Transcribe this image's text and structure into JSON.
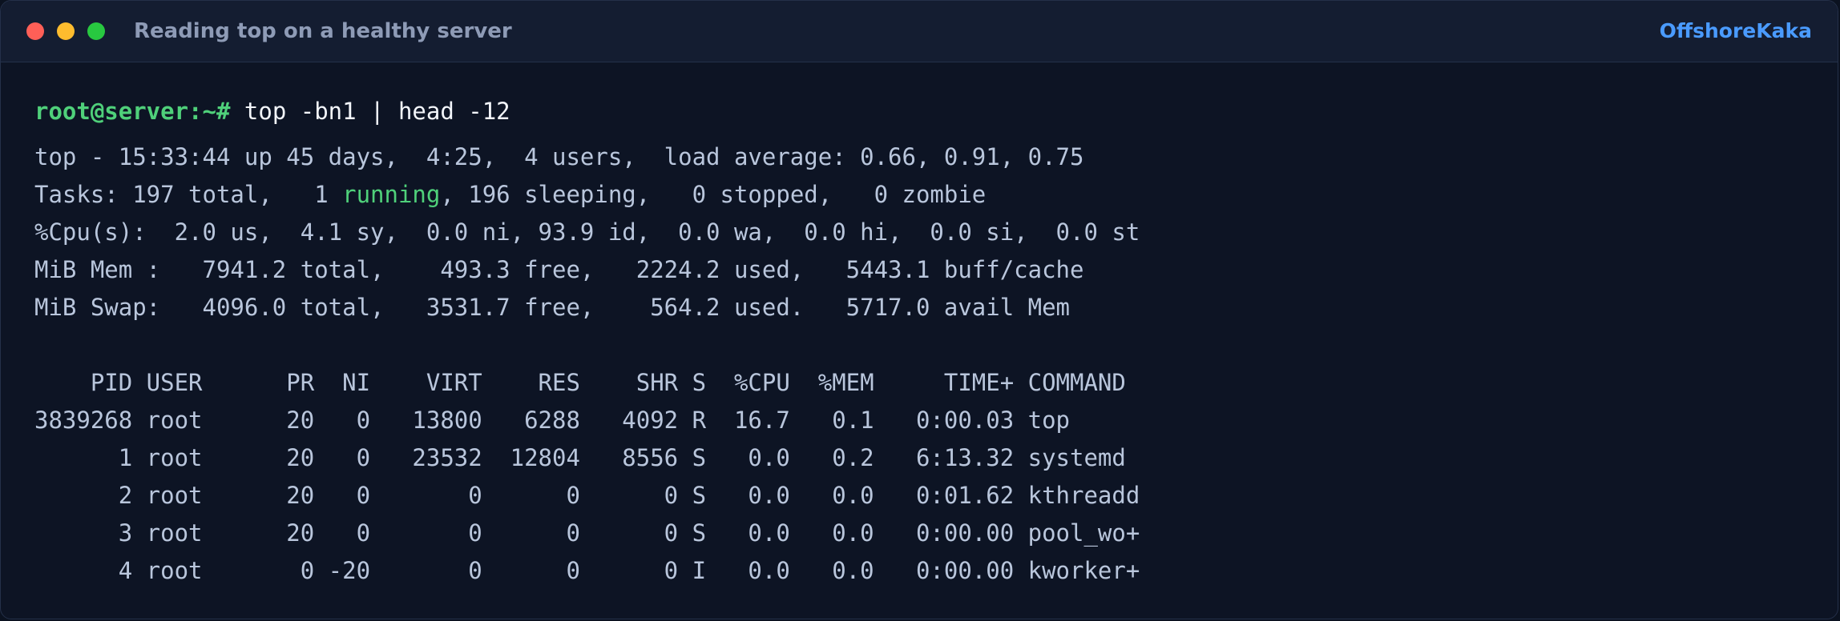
{
  "window": {
    "title": "Reading top on a healthy server",
    "brand": "OffshoreKaka",
    "controls": [
      "close",
      "minimize",
      "maximize"
    ]
  },
  "terminal": {
    "prompt": "root@server:~#",
    "command": " top -bn1 | head -12",
    "summary": {
      "uptime_line": "top - 15:33:44 up 45 days,  4:25,  4 users,  load average: 0.66, 0.91, 0.75",
      "tasks_prefix": "Tasks: 197 total,   1 ",
      "tasks_running": "running",
      "tasks_suffix": ", 196 sleeping,   0 stopped,   0 zombie",
      "cpu_line": "%Cpu(s):  2.0 us,  4.1 sy,  0.0 ni, 93.9 id,  0.0 wa,  0.0 hi,  0.0 si,  0.0 st",
      "mem_line": "MiB Mem :   7941.2 total,    493.3 free,   2224.2 used,   5443.1 buff/cache",
      "swap_line": "MiB Swap:   4096.0 total,   3531.7 free,    564.2 used.   5717.0 avail Mem"
    },
    "process_header": "    PID USER      PR  NI    VIRT    RES    SHR S  %CPU  %MEM     TIME+ COMMAND",
    "processes": [
      "3839268 root      20   0   13800   6288   4092 R  16.7   0.1   0:00.03 top",
      "      1 root      20   0   23532  12804   8556 S   0.0   0.2   6:13.32 systemd",
      "      2 root      20   0       0      0      0 S   0.0   0.0   0:01.62 kthreadd",
      "      3 root      20   0       0      0      0 S   0.0   0.0   0:00.00 pool_wo+",
      "      4 root       0 -20       0      0      0 I   0.0   0.0   0:00.00 kworker+"
    ]
  },
  "colors": {
    "background": "#0d1424",
    "titlebar": "#141d31",
    "prompt": "#4fd07a",
    "running": "#4fd07a",
    "text": "#b9c6dc",
    "brand": "#4a9bff"
  }
}
